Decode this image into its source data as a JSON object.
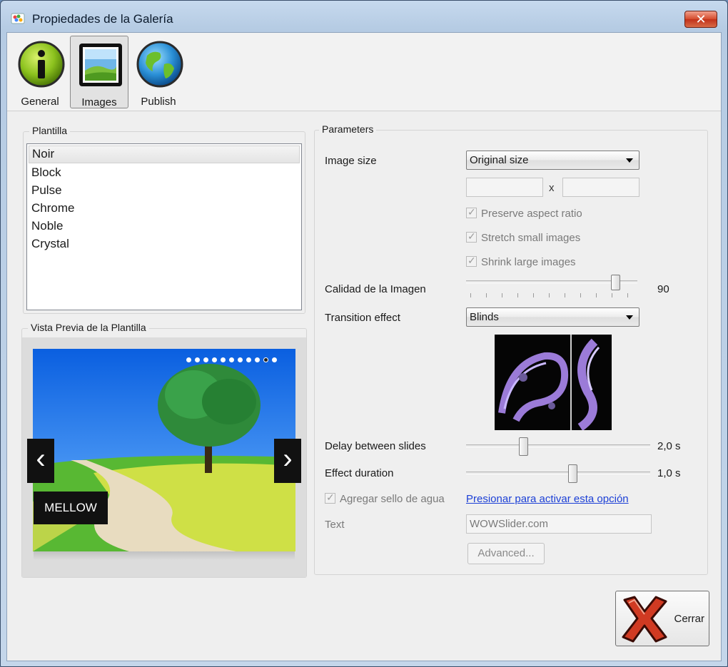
{
  "window": {
    "title": "Propiedades de la Galería",
    "close_glyph": "✕"
  },
  "toolbar": {
    "tabs": [
      {
        "label": "General",
        "icon": "info-icon"
      },
      {
        "label": "Images",
        "icon": "picture-icon",
        "active": true
      },
      {
        "label": "Publish",
        "icon": "globe-icon"
      }
    ]
  },
  "templates": {
    "legend": "Plantilla",
    "items": [
      "Noir",
      "Block",
      "Pulse",
      "Chrome",
      "Noble",
      "Crystal"
    ],
    "selected": "Noir"
  },
  "preview": {
    "legend": "Vista Previa de la Plantilla",
    "caption": "MELLOW",
    "prev_glyph": "‹",
    "next_glyph": "›",
    "bullet_count": 11,
    "active_bullet": 9
  },
  "params": {
    "legend": "Parameters",
    "image_size": {
      "label": "Image size",
      "value": "Original size",
      "x_sep": "x",
      "width": "",
      "height": ""
    },
    "preserve_aspect": {
      "label": "Preserve aspect ratio",
      "checked": true
    },
    "stretch_small": {
      "label": "Stretch small images",
      "checked": true
    },
    "shrink_large": {
      "label": "Shrink large images",
      "checked": true
    },
    "quality": {
      "label": "Calidad de la Imagen",
      "value": "90",
      "level": 0.9
    },
    "transition": {
      "label": "Transition effect",
      "value": "Blinds"
    },
    "delay": {
      "label": "Delay between slides",
      "value": "2,0 s",
      "level": 0.3
    },
    "duration": {
      "label": "Effect duration",
      "value": "1,0 s",
      "level": 0.57
    },
    "watermark": {
      "label": "Agregar sello de agua",
      "checked": true,
      "link": "Presionar para activar esta opción"
    },
    "text": {
      "label": "Text",
      "value": "WOWSlider.com"
    },
    "advanced": "Advanced..."
  },
  "footer": {
    "close_label": "Cerrar"
  },
  "colors": {
    "accent_link": "#1b3fd6",
    "close_red": "#d03a22"
  }
}
